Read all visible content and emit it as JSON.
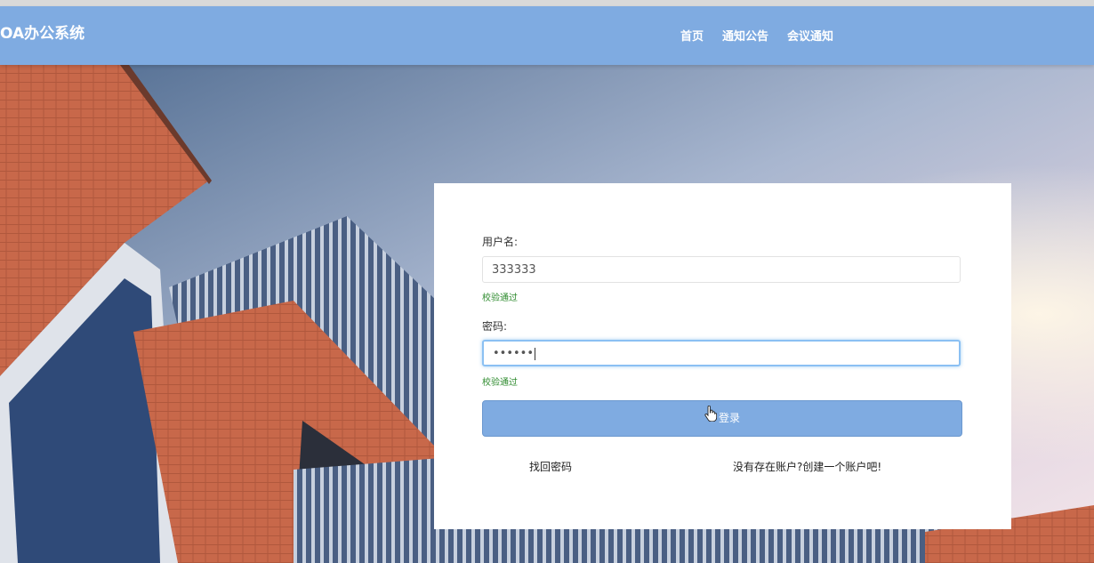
{
  "header": {
    "brand": "OA办公系统",
    "nav": [
      "首页",
      "通知公告",
      "会议通知"
    ]
  },
  "login": {
    "username_label": "用户名:",
    "username_value": "333333",
    "username_hint": "校验通过",
    "password_label": "密码:",
    "password_value": "••••••",
    "password_hint": "校验通过",
    "submit_label": "登录",
    "forgot_link": "找回密码",
    "register_link": "没有存在账户?创建一个账户吧!"
  },
  "colors": {
    "navbar": "#7fabe1",
    "button": "#7fabe1",
    "valid_hint": "#2e8b2e"
  }
}
